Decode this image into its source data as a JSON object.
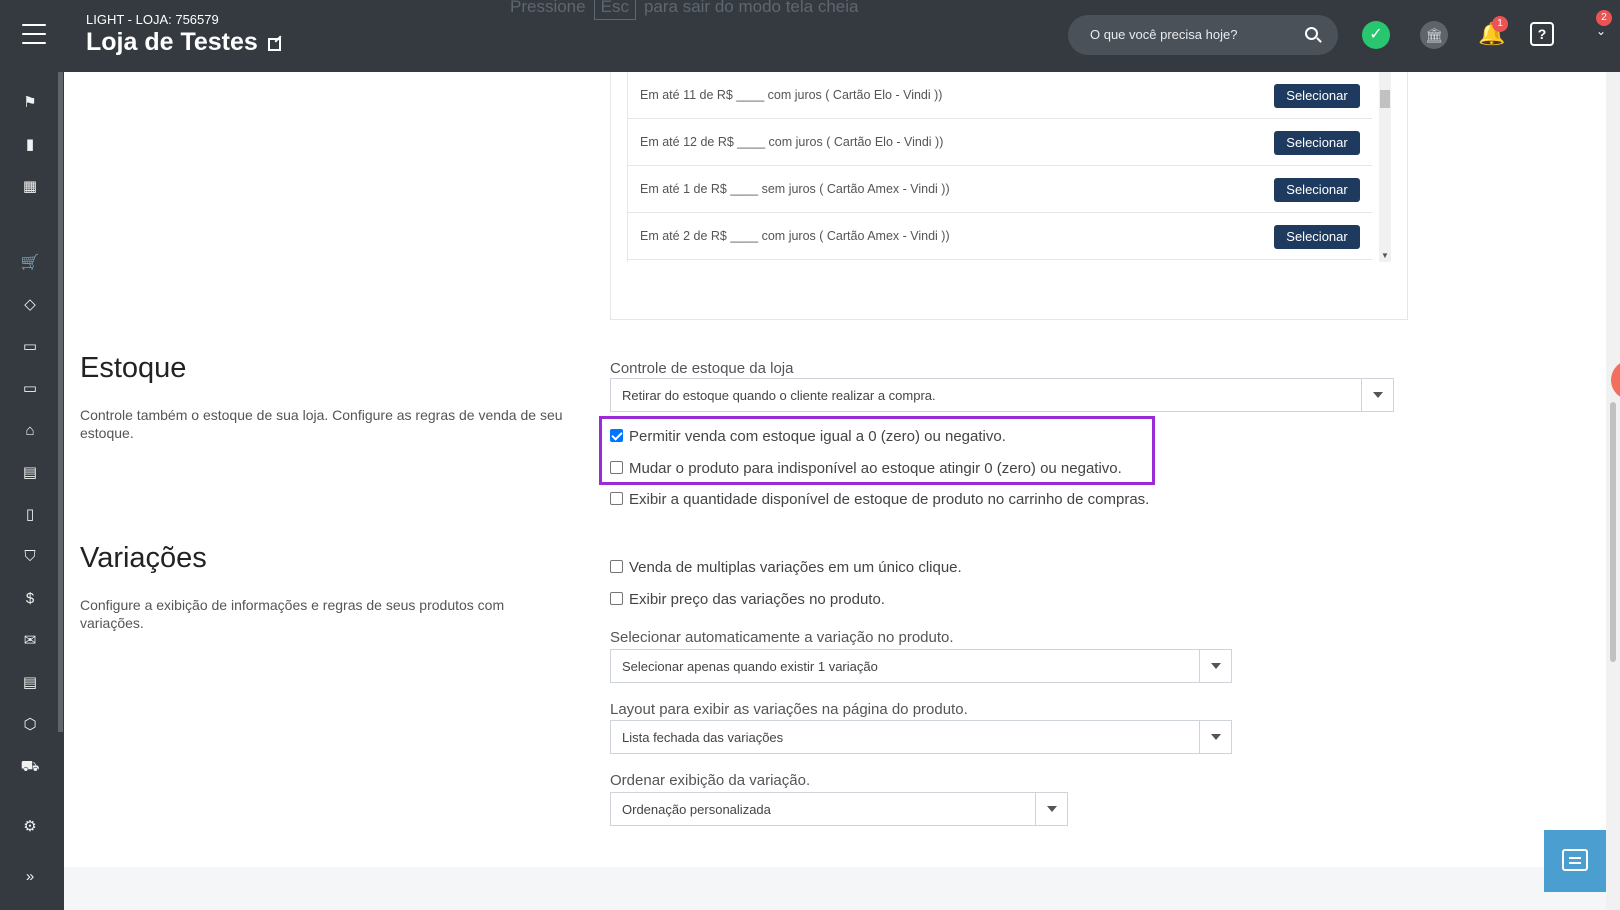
{
  "header": {
    "store_sub": "LIGHT - LOJA: 756579",
    "store_title": "Loja de Testes",
    "fullscreen_hint_before": "Pressione",
    "fullscreen_hint_key": "Esc",
    "fullscreen_hint_after": "para sair do modo tela cheia",
    "search_placeholder": "O que você precisa hoje?",
    "notification_count": "1",
    "dropdown_count": "2"
  },
  "sidebar": {
    "icons": [
      "flag-icon",
      "bar-chart-icon",
      "calendar-icon",
      "cart-icon",
      "tag-icon",
      "tv-icon",
      "monitor-icon",
      "home-icon",
      "layout-icon",
      "mobile-icon",
      "shirt-icon",
      "dollar-icon",
      "mail-icon",
      "document-icon",
      "box-icon",
      "truck-icon",
      "gear-icon",
      "chevrons-right-icon"
    ]
  },
  "installments": {
    "button_label": "Selecionar",
    "rows": [
      "Em até 11 de R$ ____ com juros ( Cartão Elo - Vindi ))",
      "Em até 12 de R$ ____ com juros ( Cartão Elo - Vindi ))",
      "Em até 1 de R$ ____ sem juros ( Cartão Amex - Vindi ))",
      "Em até 2 de R$ ____ com juros ( Cartão Amex - Vindi ))"
    ]
  },
  "estoque": {
    "title": "Estoque",
    "description": "Controle também o estoque de sua loja. Configure as regras de venda de seu estoque.",
    "control_label": "Controle de estoque da loja",
    "control_value": "Retirar do estoque quando o cliente realizar a compra.",
    "options": [
      {
        "label": "Permitir venda com estoque igual a 0 (zero) ou negativo.",
        "checked": true
      },
      {
        "label": "Mudar o produto para indisponível ao estoque atingir 0 (zero) ou negativo.",
        "checked": false
      },
      {
        "label": "Exibir a quantidade disponível de estoque de produto no carrinho de compras.",
        "checked": false
      }
    ]
  },
  "variacoes": {
    "title": "Variações",
    "description": "Configure a exibição de informações e regras de seus produtos com variações.",
    "options": [
      {
        "label": "Venda de multiplas variações em um único clique.",
        "checked": false
      },
      {
        "label": "Exibir preço das variações no produto.",
        "checked": false
      }
    ],
    "auto_select_label": "Selecionar automaticamente a variação no produto.",
    "auto_select_value": "Selecionar apenas quando existir 1 variação",
    "layout_label": "Layout para exibir as variações na página do produto.",
    "layout_value": "Lista fechada das variações",
    "order_label": "Ordenar exibição da variação.",
    "order_value": "Ordenação personalizada"
  },
  "colors": {
    "topbar": "#343a40",
    "button": "#1f3a5f",
    "highlight": "#9b2bd6",
    "checkbox": "#0075ff"
  }
}
